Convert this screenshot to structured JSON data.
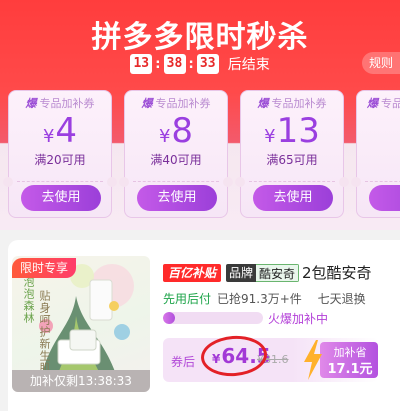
{
  "header": {
    "title": "拼多多限时秒杀",
    "countdown": {
      "hours": "13",
      "minutes": "38",
      "seconds": "33",
      "suffix": "后结束"
    },
    "rules_label": "规则"
  },
  "coupons": [
    {
      "tag": "爆",
      "head": "专品加补券",
      "amount": "4",
      "condition": "满20可用",
      "button": "去使用"
    },
    {
      "tag": "爆",
      "head": "专品加补券",
      "amount": "8",
      "condition": "满40可用",
      "button": "去使用"
    },
    {
      "tag": "爆",
      "head": "专品加补券",
      "amount": "13",
      "condition": "满65可用",
      "button": "去使用"
    },
    {
      "tag": "爆",
      "head": "专品加补券",
      "amount": "",
      "condition": "",
      "button": ""
    }
  ],
  "currency_symbol": "¥",
  "product": {
    "promo_badge": "限时专享",
    "image_text": [
      "泡泡森林",
      "贴身呵护新生肌"
    ],
    "bottom_banner": "加补仅剩13:38:33",
    "subsidy_tag": "百亿补贴",
    "brand_key": "品牌",
    "brand_value": "酷安奇",
    "title": "2包酷安奇",
    "service": {
      "highlight": "先用后付",
      "sold": "已抢91.3万+件",
      "returns": "七天退换"
    },
    "progress": {
      "fraction": 0.05,
      "label": "火爆加补中"
    },
    "price": {
      "label": "券后",
      "current": "64.5",
      "original": "81.6"
    },
    "save": {
      "label": "加补省",
      "amount": "17.1元"
    }
  },
  "colors": {
    "header_red": "#ff3d3d",
    "coupon_purple": "#9a3fe0",
    "button_purple": "#b04fdc",
    "annotation_red": "#e32127",
    "subsidy_red": "#ff2a2a"
  },
  "icons": [
    "lightning-icon"
  ]
}
